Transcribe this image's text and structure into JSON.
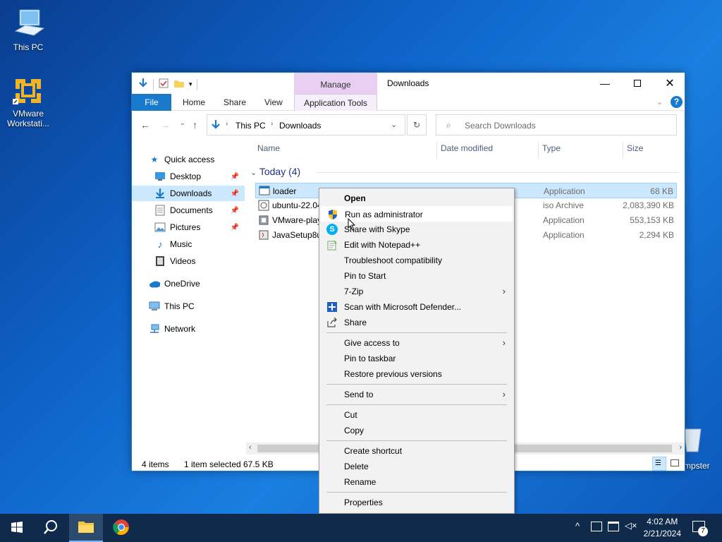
{
  "desktop": {
    "this_pc_label": "This PC",
    "vmware_label_1": "VMware",
    "vmware_label_2": "Workstati...",
    "recycle_label": "mpster"
  },
  "window": {
    "title": "Downloads",
    "manage_tab": "Manage",
    "ribbon_tabs": [
      "File",
      "Home",
      "Share",
      "View",
      "Application Tools"
    ],
    "address": {
      "root": "This PC",
      "current": "Downloads"
    },
    "search_placeholder": "Search Downloads"
  },
  "leftnav": {
    "items": [
      {
        "label": "Quick access",
        "icon": "star-icon"
      },
      {
        "label": "Desktop",
        "icon": "desktop-folder-icon"
      },
      {
        "label": "Downloads",
        "icon": "download-folder-icon"
      },
      {
        "label": "Documents",
        "icon": "documents-folder-icon"
      },
      {
        "label": "Pictures",
        "icon": "pictures-folder-icon"
      },
      {
        "label": "Music",
        "icon": "music-folder-icon"
      },
      {
        "label": "Videos",
        "icon": "videos-folder-icon"
      },
      {
        "label": "OneDrive",
        "icon": "cloud-icon"
      },
      {
        "label": "This PC",
        "icon": "computer-icon"
      },
      {
        "label": "Network",
        "icon": "network-icon"
      }
    ]
  },
  "filelist": {
    "columns": [
      "Name",
      "Date modified",
      "Type",
      "Size"
    ],
    "group": "Today (4)",
    "rows": [
      {
        "name": "loader",
        "type": "Application",
        "size": "68 KB"
      },
      {
        "name": "ubuntu-22.04",
        "type": "iso Archive",
        "size": "2,083,390 KB"
      },
      {
        "name": "VMware-play",
        "type": "Application",
        "size": "553,153 KB"
      },
      {
        "name": "JavaSetup8u",
        "type": "Application",
        "size": "2,294 KB"
      }
    ]
  },
  "status": {
    "count": "4 items",
    "selected": "1 item selected",
    "size": "67.5 KB"
  },
  "context_menu": {
    "items": [
      "Open",
      "Run as administrator",
      "Share with Skype",
      "Edit with Notepad++",
      "Troubleshoot compatibility",
      "Pin to Start",
      "7-Zip",
      "Scan with Microsoft Defender...",
      "Share",
      "Give access to",
      "Pin to taskbar",
      "Restore previous versions",
      "Send to",
      "Cut",
      "Copy",
      "Create shortcut",
      "Delete",
      "Rename",
      "Properties"
    ]
  },
  "taskbar": {
    "time": "4:02 AM",
    "date": "2/21/2024",
    "notification_count": "7"
  },
  "colors": {
    "accent": "#1979ca",
    "selection": "#cce8ff",
    "manage_tab": "#e9d0f3",
    "taskbar": "#0f2a4a"
  }
}
